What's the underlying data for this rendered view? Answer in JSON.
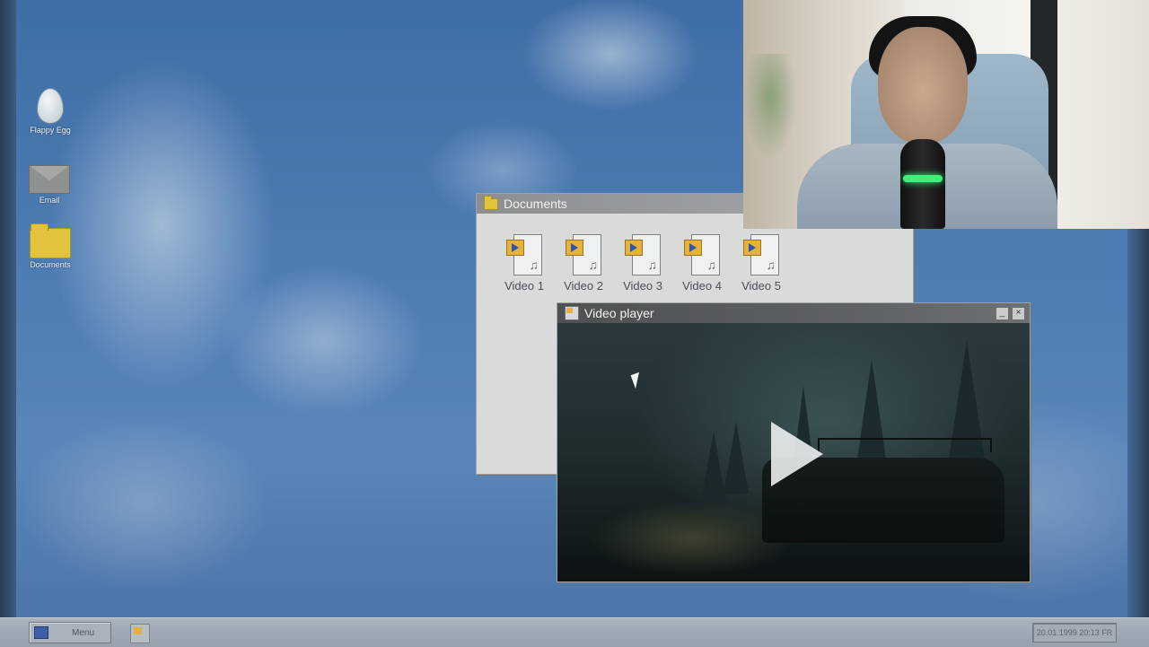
{
  "desktop": {
    "icons": [
      {
        "label": "Flappy Egg",
        "icon": "egg-icon"
      },
      {
        "label": "Email",
        "icon": "envelope-icon"
      },
      {
        "label": "Documents",
        "icon": "folder-icon"
      }
    ]
  },
  "documents_window": {
    "title": "Documents",
    "files": [
      {
        "label": "Video 1"
      },
      {
        "label": "Video 2"
      },
      {
        "label": "Video 3"
      },
      {
        "label": "Video 4"
      },
      {
        "label": "Video 5"
      }
    ]
  },
  "video_window": {
    "title": "Video player",
    "minimize_label": "_",
    "close_label": "×"
  },
  "taskbar": {
    "menu_label": "Menu",
    "clock": "20.01.1999 20:13 FR"
  },
  "colors": {
    "accent_folder": "#e2c33e",
    "titlebar": "#6f7275",
    "taskbar": "#a9b3bd"
  }
}
